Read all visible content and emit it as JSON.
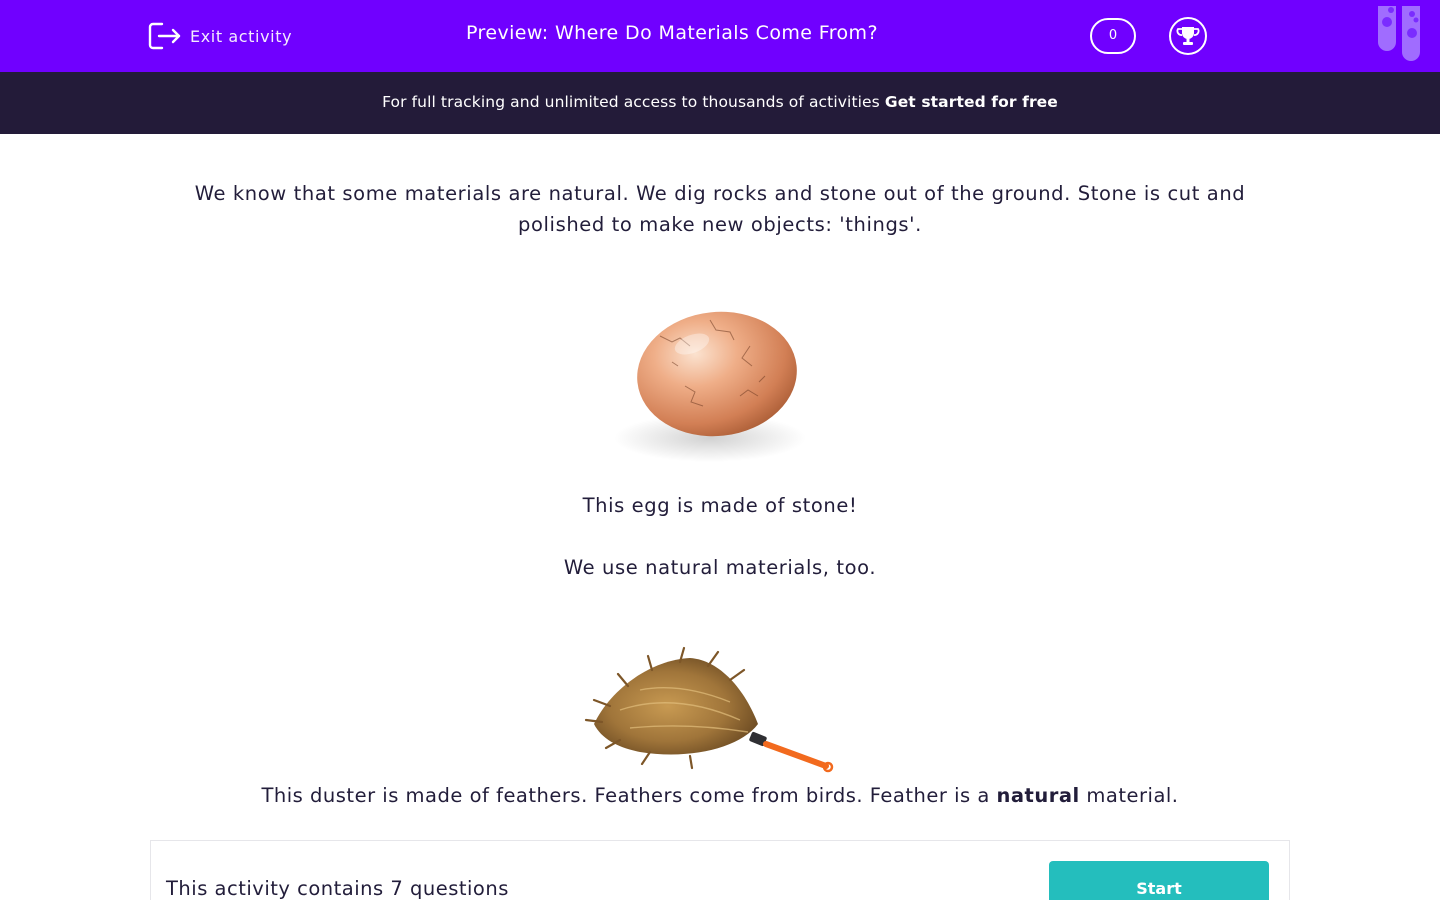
{
  "header": {
    "exit_label": "Exit activity",
    "title": "Preview: Where Do Materials Come From?",
    "score": "0",
    "exit_icon": "exit-icon",
    "trophy_icon": "trophy-icon",
    "tubes_decoration": "test-tubes-logo",
    "background_color": "#7000ff"
  },
  "banner": {
    "text": "For full tracking and unlimited access to thousands of activities",
    "cta": "Get started for free",
    "background_color": "#231b39"
  },
  "content": {
    "intro": "We know that some materials are natural. We dig rocks and stone out of the ground. Stone is cut and polished to make new objects: 'things'.",
    "egg_image": "stone-egg-image",
    "egg_caption": "This egg is made of stone!",
    "natural_too": "We use natural materials, too.",
    "duster_image": "feather-duster-image",
    "duster_text_before": "This duster is made of feathers. Feathers come from birds. Feather is a",
    "duster_text_bold": "natural",
    "duster_text_after": "material."
  },
  "activity": {
    "question_count_text": "This activity contains 7 questions",
    "start_label": "Start",
    "start_color": "#24bebd"
  }
}
